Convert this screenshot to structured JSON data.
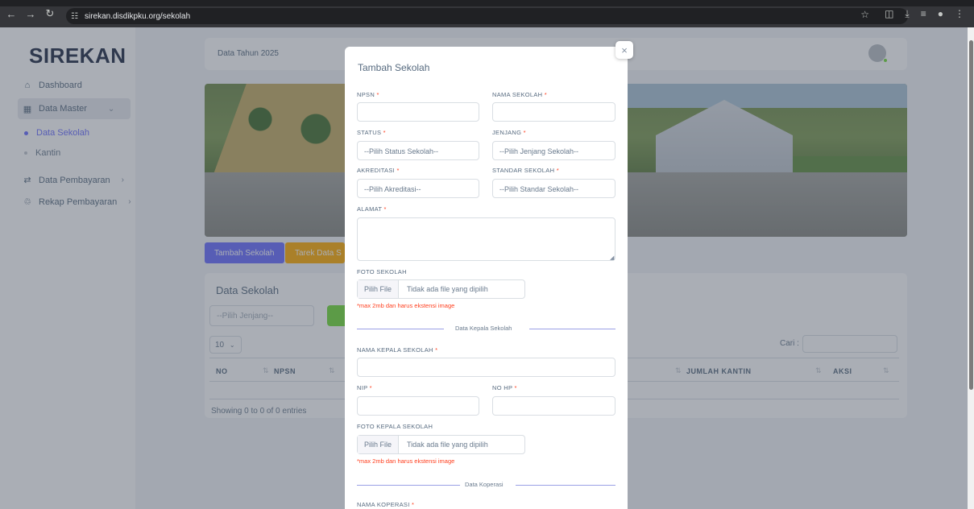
{
  "browser": {
    "url": "sirekan.disdikpku.org/sekolah"
  },
  "sidebar": {
    "brand": "SIREKAN",
    "items": [
      {
        "label": "Dashboard"
      },
      {
        "label": "Data Master"
      },
      {
        "label": "Data Pembayaran"
      },
      {
        "label": "Rekap Pembayaran"
      }
    ],
    "submenu": [
      {
        "label": "Data Sekolah"
      },
      {
        "label": "Kantin"
      }
    ]
  },
  "topbar": {
    "year_label": "Data Tahun 2025"
  },
  "actions": {
    "add_label": "Tambah Sekolah",
    "pull_label": "Tarek Data S"
  },
  "table_card": {
    "title": "Data Sekolah",
    "jenjang_placeholder": "--Pilih Jenjang--",
    "page_length": "10",
    "search_label": "Cari :",
    "columns": [
      "NO",
      "NPSN",
      "JUMLAH KANTIN",
      "AKSI"
    ],
    "showing": "Showing 0 to 0 of 0 entries"
  },
  "modal": {
    "title": "Tambah Sekolah",
    "fields": {
      "npsn": "NPSN",
      "nama_sekolah": "NAMA SEKOLAH",
      "status": "STATUS",
      "jenjang": "JENJANG",
      "akreditasi": "AKREDITASI",
      "standar": "STANDAR SEKOLAH",
      "alamat": "ALAMAT",
      "foto_sekolah": "FOTO SEKOLAH",
      "nama_kepala": "NAMA KEPALA SEKOLAH",
      "nip": "NIP",
      "no_hp": "NO HP",
      "foto_kepala": "FOTO KEPALA SEKOLAH",
      "nama_koperasi": "NAMA KOPERASI"
    },
    "selects": {
      "status": "--Pilih Status Sekolah--",
      "jenjang": "--Pilih Jenjang Sekolah--",
      "akreditasi": "--Pilih Akreditasi--",
      "standar": "--Pilih Standar Sekolah--"
    },
    "file": {
      "button": "Pilih File",
      "empty": "Tidak ada file yang dipilih",
      "hint": "*max 2mb dan harus ekstensi image"
    },
    "sections": {
      "kepala": "Data Kepala Sekolah",
      "koperasi": "Data Koperasi"
    },
    "required_mark": "*"
  },
  "colors": {
    "primary": "#696cff",
    "warning": "#ffab00",
    "success": "#71dd37",
    "danger": "#ff3e1d"
  }
}
